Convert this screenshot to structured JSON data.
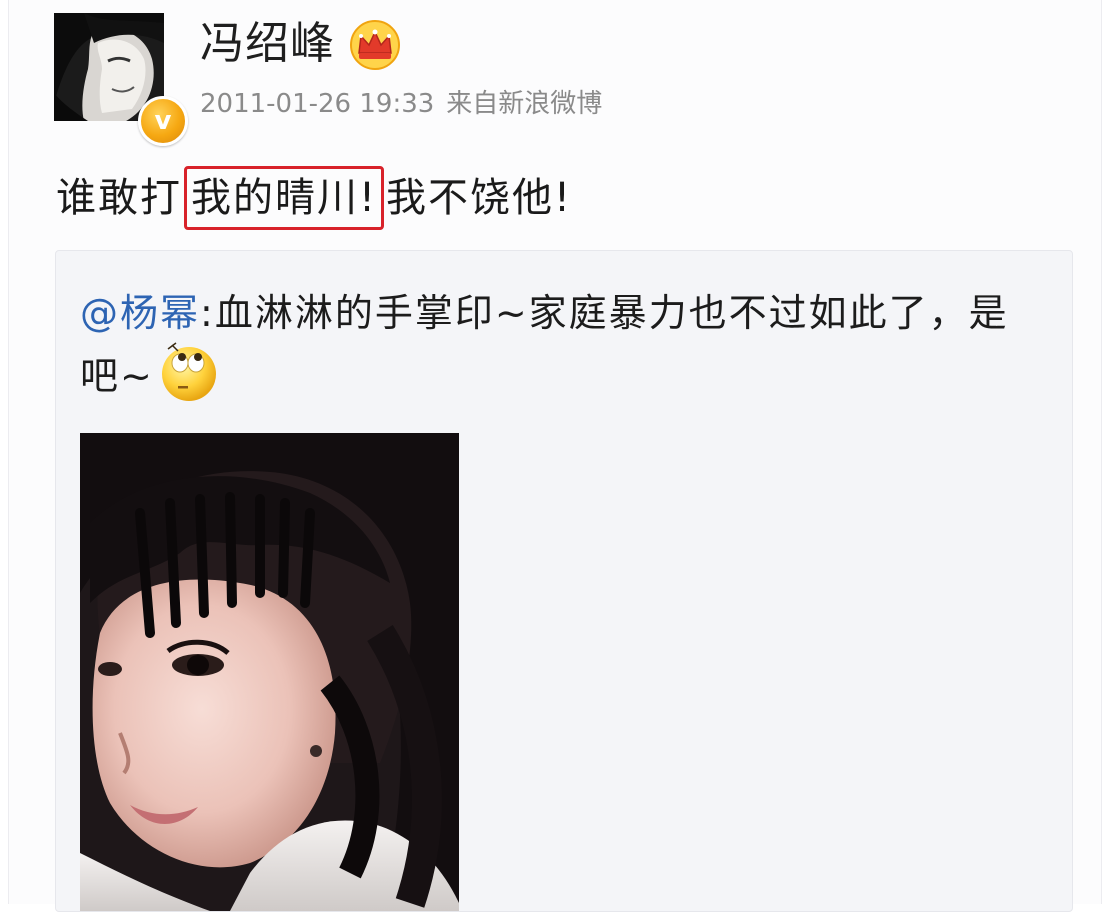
{
  "post": {
    "author": "冯绍峰",
    "timestamp": "2011-01-26 19:33",
    "source": "来自新浪微博",
    "text_before": "谁敢打",
    "text_highlight": "我的晴川!",
    "text_after": "我不饶他!",
    "badge_letter": "v",
    "avatar_icon": "user-avatar",
    "membership_icon": "crown-icon"
  },
  "repost": {
    "mention": "@杨幂",
    "text": ":血淋淋的手掌印~家庭暴力也不过如此了，是吧~",
    "emoji_icon": "rolling-eyes-emoji",
    "photo_icon": "selfie-photo"
  },
  "colors": {
    "mention_blue": "#2d64b3",
    "highlight_red": "#d8222a",
    "badge_orange": "#f6a812",
    "repost_background": "#f4f5f8"
  }
}
